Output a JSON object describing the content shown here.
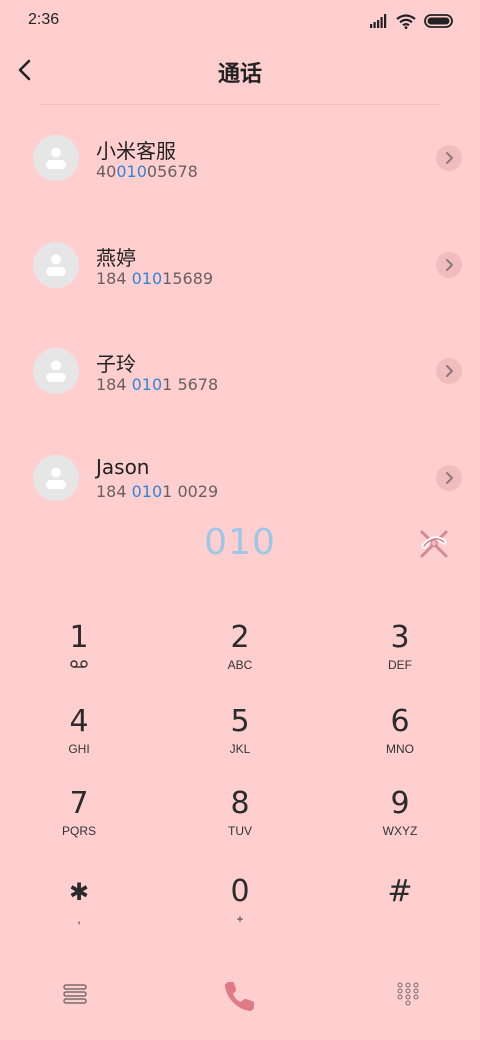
{
  "status_bar": {
    "time": "2:36"
  },
  "header": {
    "title": "通话"
  },
  "contacts": [
    {
      "name": "小米客服",
      "number_pre": "40",
      "number_match": "010",
      "number_post": "05678"
    },
    {
      "name": "燕婷",
      "number_pre": "184 ",
      "number_match": "010",
      "number_post": "15689"
    },
    {
      "name": "子玲",
      "number_pre": "184 ",
      "number_match": "010",
      "number_post": "1 5678"
    },
    {
      "name": "Jason",
      "number_pre": "184 ",
      "number_match": "010",
      "number_post": "1 0029"
    }
  ],
  "dial_display": "010",
  "keypad": [
    {
      "digit": "1",
      "letters": "",
      "sub_icon": "voicemail-icon"
    },
    {
      "digit": "2",
      "letters": "ABC"
    },
    {
      "digit": "3",
      "letters": "DEF"
    },
    {
      "digit": "4",
      "letters": "GHI"
    },
    {
      "digit": "5",
      "letters": "JKL"
    },
    {
      "digit": "6",
      "letters": "MNO"
    },
    {
      "digit": "7",
      "letters": "PQRS"
    },
    {
      "digit": "8",
      "letters": "TUV"
    },
    {
      "digit": "9",
      "letters": "WXYZ"
    },
    {
      "digit": "✱",
      "letters": ","
    },
    {
      "digit": "0",
      "letters": "+"
    },
    {
      "digit": "#",
      "letters": ""
    }
  ],
  "colors": {
    "background": "#ffcfd0",
    "highlight": "#2f86d8",
    "call": "#e07a86"
  },
  "icons": {
    "back": "back-arrow-icon",
    "clear": "clear-input-icon",
    "menu": "menu-icon",
    "call": "phone-icon",
    "dialpad": "dialpad-icon"
  }
}
